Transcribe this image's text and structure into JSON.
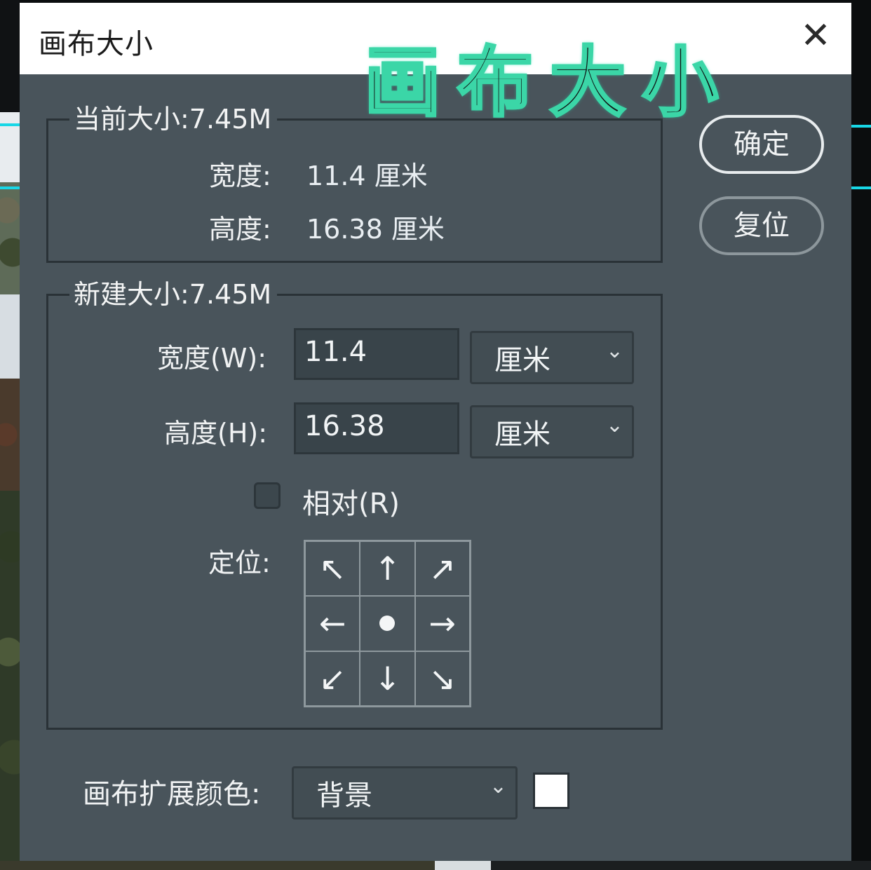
{
  "window": {
    "title": "画布大小",
    "close_glyph": "✕"
  },
  "overlay_title": "画布大小",
  "current_size": {
    "legend": "当前大小:7.45M",
    "width_label": "宽度:",
    "width_value": "11.4 厘米",
    "height_label": "高度:",
    "height_value": "16.38 厘米"
  },
  "new_size": {
    "legend": "新建大小:7.45M",
    "width_label": "宽度(W):",
    "width_value": "11.4",
    "width_unit": "厘米",
    "height_label": "高度(H):",
    "height_value": "16.38",
    "height_unit": "厘米",
    "relative_label": "相对(R)",
    "relative_checked": false,
    "anchor_label": "定位:",
    "anchor_icons": [
      "arrow-up-left-icon",
      "arrow-up-icon",
      "arrow-up-right-icon",
      "arrow-left-icon",
      "anchor-center-icon",
      "arrow-right-icon",
      "arrow-down-left-icon",
      "arrow-down-icon",
      "arrow-down-right-icon"
    ]
  },
  "extension_color": {
    "label": "画布扩展颜色:",
    "value": "背景",
    "swatch_color": "#ffffff"
  },
  "buttons": {
    "ok": "确定",
    "reset": "复位"
  },
  "chevron_glyph": "⌄",
  "arrows": {
    "up_left": "↖",
    "up": "↑",
    "up_right": "↗",
    "left": "←",
    "right": "→",
    "down_left": "↙",
    "down": "↓",
    "down_right": "↘"
  },
  "colors": {
    "dialog_bg": "#49545b",
    "accent_overlay": "#3bd6a7",
    "marker": "#18d7e6"
  }
}
